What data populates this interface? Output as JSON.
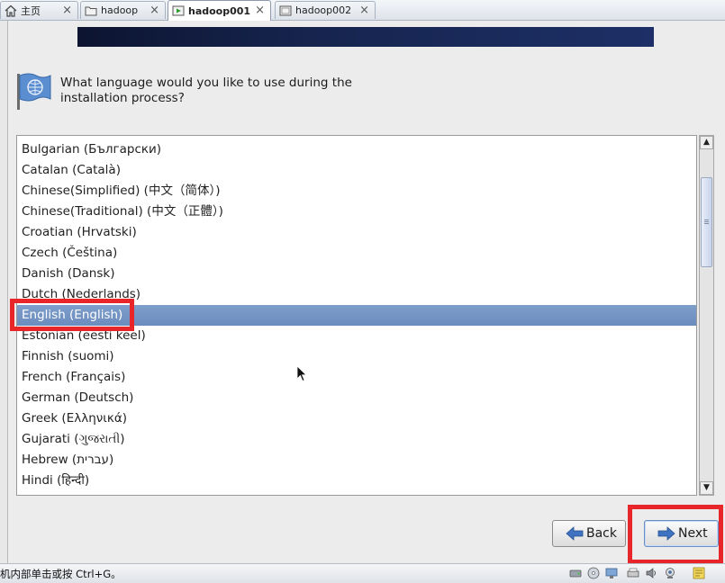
{
  "tabs": [
    {
      "label": "主页",
      "icon": "home-icon"
    },
    {
      "label": "hadoop",
      "icon": "vm-icon"
    },
    {
      "label": "hadoop001",
      "icon": "vm-running-icon",
      "active": true
    },
    {
      "label": "hadoop002",
      "icon": "vm-icon"
    }
  ],
  "tab_close_glyph": "×",
  "installer": {
    "question": "What language would you like to use during the installation process?",
    "languages": [
      "Bulgarian (Български)",
      "Catalan (Català)",
      "Chinese(Simplified) (中文（简体）)",
      "Chinese(Traditional) (中文（正體）)",
      "Croatian (Hrvatski)",
      "Czech (Čeština)",
      "Danish (Dansk)",
      "Dutch (Nederlands)",
      "English (English)",
      "Estonian (eesti keel)",
      "Finnish (suomi)",
      "French (Français)",
      "German (Deutsch)",
      "Greek (Ελληνικά)",
      "Gujarati (ગુજરાતી)",
      "Hebrew (עברית)",
      "Hindi (हिन्दी)"
    ],
    "selected_index": 8,
    "back_label": "Back",
    "next_label": "Next"
  },
  "statusbar": {
    "hint": "机内部单击或按 Ctrl+G。",
    "devices": [
      "hard-disk-icon",
      "cd-drive-icon",
      "network-adapter-icon",
      "printer-icon",
      "sound-icon",
      "webcam-icon",
      "message-icon"
    ]
  },
  "colors": {
    "selection": "#6b8cbe",
    "highlight_box": "#e8262a",
    "banner": "#16244e"
  }
}
